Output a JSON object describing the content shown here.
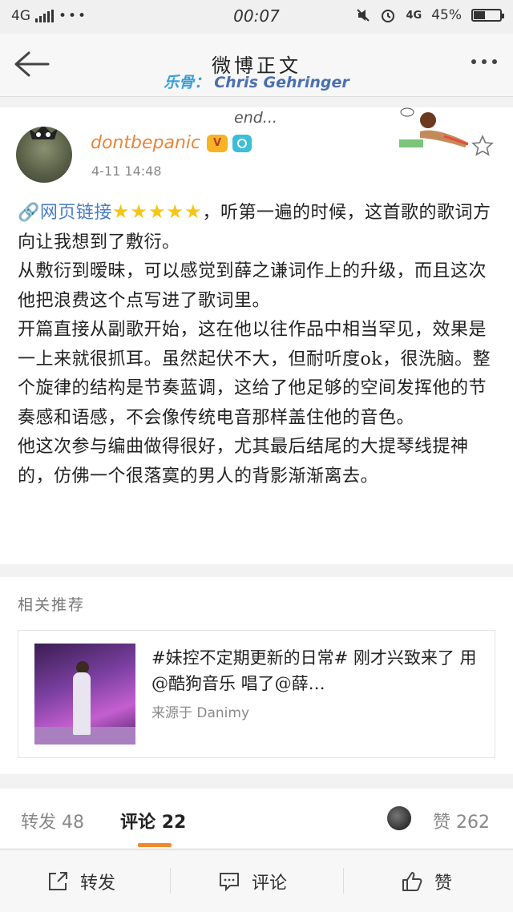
{
  "status_bar": {
    "network": "4G",
    "time": "00:07",
    "network_right": "4G",
    "battery_percent": "45%",
    "battery_level": 0.45
  },
  "nav": {
    "title": "微博正文",
    "subtitle_prefix": "乐骨：",
    "subtitle_name": "Chris Gehringer"
  },
  "post": {
    "end_label": "end...",
    "username": "dontbepanic",
    "timestamp": "4-11 14:48",
    "link_text": "🔗网页链接",
    "stars": "★★★★★",
    "line1_rest": "，听第一遍的时候，这首歌的歌词方向让我想到了敷衍。",
    "para2": "从敷衍到暧昧，可以感觉到薛之谦词作上的升级，而且这次他把浪费这个点写进了歌词里。",
    "para3": "开篇直接从副歌开始，这在他以往作品中相当罕见，效果是一上来就很抓耳。虽然起伏不大，但耐听度ok，很洗脑。整个旋律的结构是节奏蓝调，这给了他足够的空间发挥他的节奏感和语感，不会像传统电音那样盖住他的音色。",
    "para4": "他这次参与编曲做得很好，尤其最后结尾的大提琴线提神的，仿佛一个很落寞的男人的背影渐渐离去。"
  },
  "related": {
    "title": "相关推荐",
    "card_text": "#妹控不定期更新的日常# 刚才兴致来了 用@酷狗音乐 唱了@薛…",
    "card_source": "来源于 Danimy"
  },
  "tabs": {
    "repost_label": "转发",
    "repost_count": "48",
    "comment_label": "评论",
    "comment_count": "22",
    "like_label": "赞",
    "like_count": "262"
  },
  "toolbar": {
    "repost": "转发",
    "comment": "评论",
    "like": "赞"
  },
  "colors": {
    "username": "#e8863a",
    "link": "#4a7cc7",
    "accent_underline": "#f08a2c",
    "subtitle": "#4a6fb0"
  }
}
